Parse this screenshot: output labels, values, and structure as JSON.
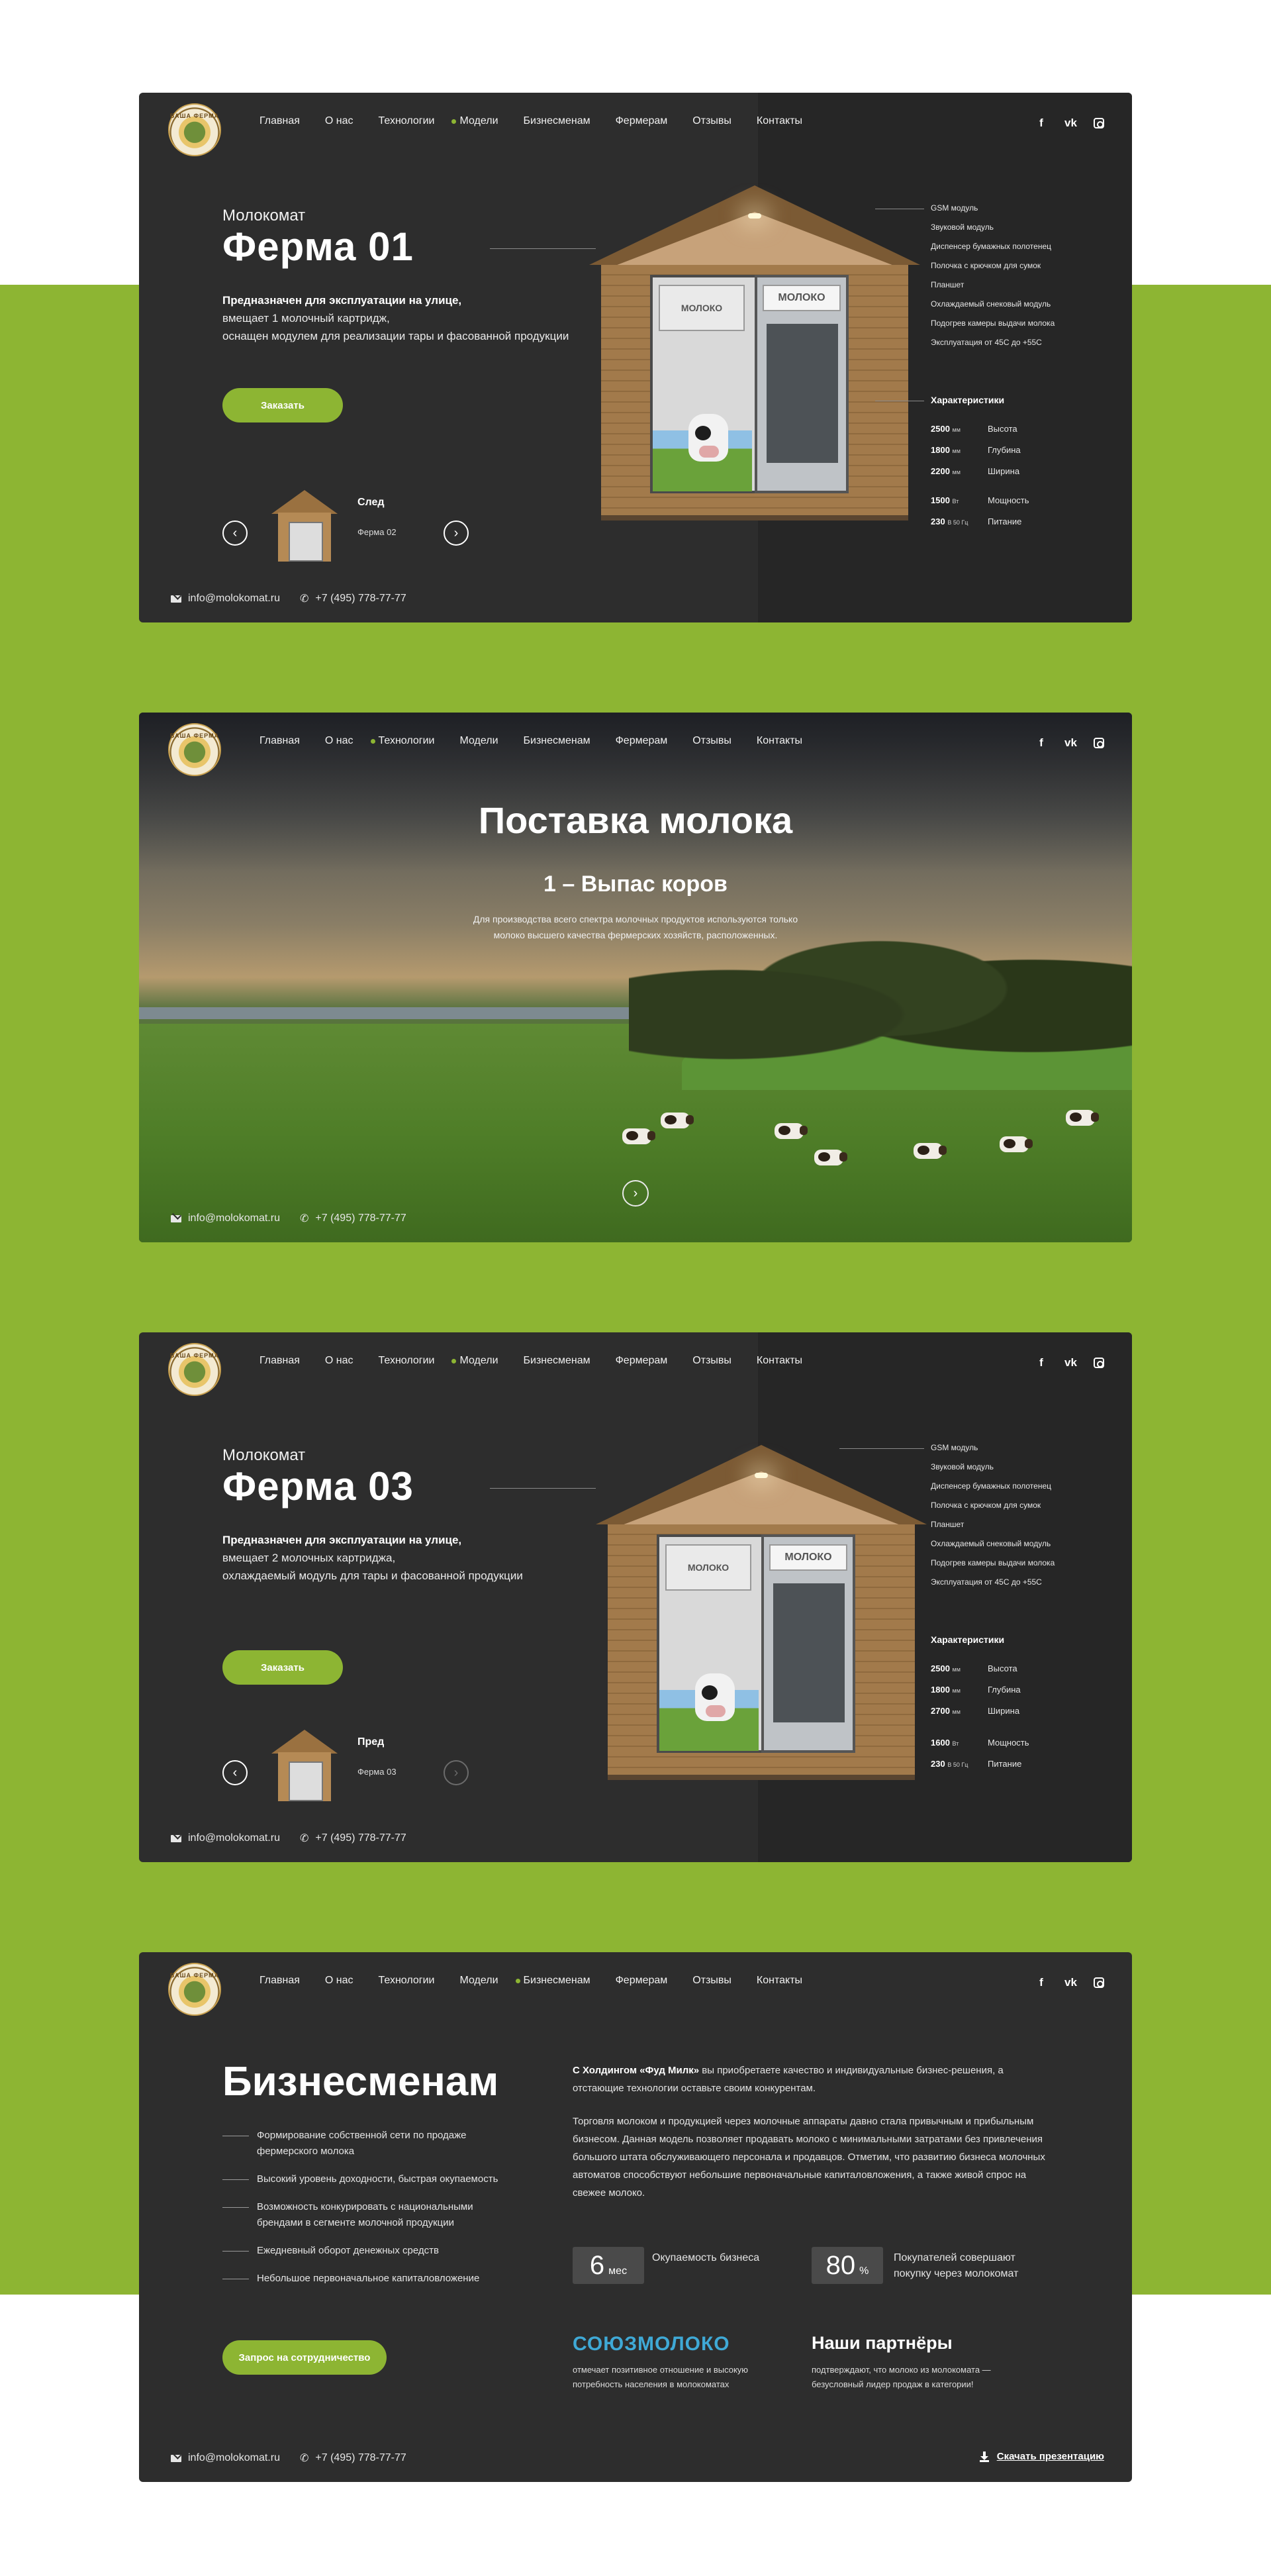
{
  "colors": {
    "accent": "#8db533",
    "card_bg": "#2d2d2d",
    "soyuz_blue": "#3fa9d6"
  },
  "brand": {
    "logo_text": "ВАША ФЕРМА"
  },
  "nav": [
    "Главная",
    "О нас",
    "Технологии",
    "Модели",
    "Бизнесменам",
    "Фермерам",
    "Отзывы",
    "Контакты"
  ],
  "socials": [
    "facebook-icon",
    "vk-icon",
    "instagram-icon"
  ],
  "contacts": {
    "email": "info@molokomat.ru",
    "phone": "+7 (495) 778-77-77"
  },
  "card1": {
    "active_nav": "Модели",
    "subtitle": "Молокомат",
    "title": "Ферма 01",
    "desc_bold": "Предназначен для эксплуатации на улице,",
    "desc_lines": [
      "вмещает 1 молочный картридж,",
      "оснащен модулем для реализации тары и фасованной продукции"
    ],
    "order_button": "Заказать",
    "slide_label": "След",
    "slide_name": "Ферма 02",
    "kiosk_sign": "МОЛОКО",
    "kiosk_sign2": "МОЛОКО",
    "features": [
      "GSM модуль",
      "Звуковой модуль",
      "Диспенсер бумажных полотенец",
      "Полочка с крючком для сумок",
      "Планшет",
      "Охлаждаемый снековый модуль",
      "Подогрев камеры выдачи молока",
      "Эксплуатация от 45С до +55С"
    ],
    "char_title": "Характеристики",
    "chars": [
      {
        "value": "2500",
        "unit": "мм",
        "label": "Высота"
      },
      {
        "value": "1800",
        "unit": "мм",
        "label": "Глубина"
      },
      {
        "value": "2200",
        "unit": "мм",
        "label": "Ширина"
      },
      {
        "value": "1500",
        "unit": "Вт",
        "label": "Мощность"
      },
      {
        "value": "230",
        "unit": "В  50 Гц",
        "label": "Питание"
      }
    ]
  },
  "card2": {
    "active_nav": "Технологии",
    "title": "Поставка молока",
    "subtitle": "1 – Выпас коров",
    "text_lines": [
      "Для производства всего спектра молочных продуктов используются только",
      "молоко высшего качества фермерских хозяйств, расположенных."
    ]
  },
  "card3": {
    "active_nav": "Модели",
    "subtitle": "Молокомат",
    "title": "Ферма 03",
    "desc_bold": "Предназначен для эксплуатации на улице,",
    "desc_lines": [
      "вмещает 2 молочных картриджа,",
      "охлаждаемый модуль для тары и фасованной продукции"
    ],
    "order_button": "Заказать",
    "slide_label": "Пред",
    "slide_name": "Ферма 03",
    "kiosk_sign": "МОЛОКО",
    "kiosk_sign2": "МОЛОКО",
    "features": [
      "GSM модуль",
      "Звуковой модуль",
      "Диспенсер бумажных полотенец",
      "Полочка с крючком для сумок",
      "Планшет",
      "Охлаждаемый снековый модуль",
      "Подогрев камеры выдачи молока",
      "Эксплуатация от 45С до +55С"
    ],
    "char_title": "Характеристики",
    "chars": [
      {
        "value": "2500",
        "unit": "мм",
        "label": "Высота"
      },
      {
        "value": "1800",
        "unit": "мм",
        "label": "Глубина"
      },
      {
        "value": "2700",
        "unit": "мм",
        "label": "Ширина"
      },
      {
        "value": "1600",
        "unit": "Вт",
        "label": "Мощность"
      },
      {
        "value": "230",
        "unit": "В  50 Гц",
        "label": "Питание"
      }
    ]
  },
  "card4": {
    "active_nav": "Бизнесменам",
    "title": "Бизнесменам",
    "list": [
      "Формирование собственной сети по продаже фермерского молока",
      "Высокий уровень доходности, быстрая окупаемость",
      "Возможность конкурировать с национальными брендами в сегменте молочной продукции",
      "Ежедневный оборот денежных средств",
      "Небольшое первоначальное капиталовложение"
    ],
    "intro_bold": "С Холдингом «Фуд Милк»",
    "intro_rest": " вы приобретаете качество и индивидуальные бизнес-решения, а отстающие технологии оставьте своим конкурентам.",
    "paragraph": "Торговля молоком и продукцией через молочные аппараты давно стала привычным и прибыльным бизнесом. Данная модель позволяет продавать молоко с минимальными затратами без привлечения большого штата обслуживающего персонала и продавцов. Отметим, что развитию бизнеса молочных автоматов способствуют небольшие первоначальные капиталовложения, а также живой спрос на свежее молоко.",
    "stat1_value": "6",
    "stat1_unit": "мес",
    "stat1_caption": "Окупаемость бизнеса",
    "stat2_value": "80",
    "stat2_unit": "%",
    "stat2_caption": "Покупателей совершают покупку через молокомат",
    "soyuz_logo": "СОЮЗМОЛОКО",
    "soyuz_note": "отмечает позитивное отношение и высокую потребность населения в молокоматах",
    "partners_title": "Наши партнёры",
    "partners_note": "подтверждают, что молоко из молокомата — безусловный лидер продаж в категории!",
    "cta_button": "Запрос на сотрудничество",
    "download": "Скачать презентацию"
  }
}
